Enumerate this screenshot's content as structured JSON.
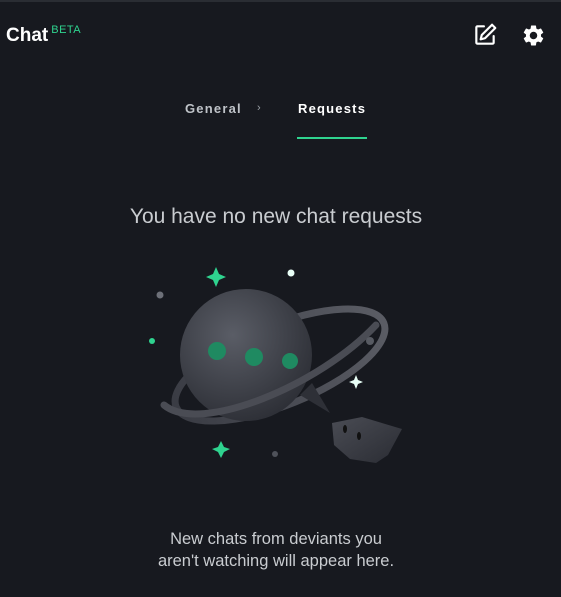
{
  "header": {
    "title": "Chat",
    "badge": "BETA",
    "compose_icon": "compose-icon",
    "settings_icon": "gear-icon"
  },
  "tabs": [
    {
      "label": "General",
      "active": false
    },
    {
      "label": "Requests",
      "active": true
    }
  ],
  "tab_separator": "›",
  "empty_state": {
    "heading": "You have no new chat requests",
    "line1": "New chats from deviants you",
    "line2": "aren't watching will appear here."
  },
  "colors": {
    "background": "#17191f",
    "accent": "#2fd38f",
    "text": "#c9ccd0"
  }
}
